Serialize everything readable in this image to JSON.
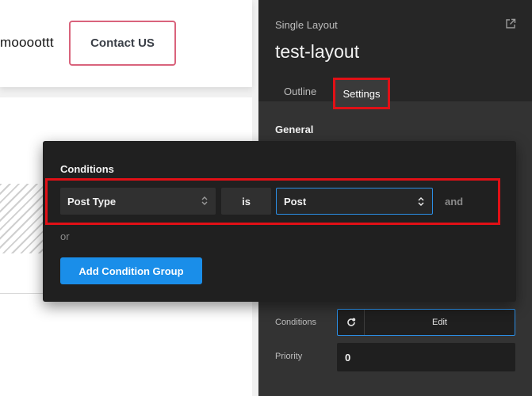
{
  "preview": {
    "brand_text": "moooottt",
    "contact_button": "Contact US"
  },
  "panel": {
    "subtitle": "Single Layout",
    "title": "test-layout",
    "tabs": [
      {
        "label": "Outline",
        "active": false
      },
      {
        "label": "Settings",
        "active": true
      }
    ],
    "section_general": "General",
    "conditions_label": "Conditions",
    "conditions_edit": "Edit",
    "priority_label": "Priority",
    "priority_value": "0"
  },
  "popover": {
    "title": "Conditions",
    "condition": {
      "type": "Post Type",
      "operator": "is",
      "value": "Post",
      "conjunction": "and"
    },
    "or_text": "or",
    "add_group_button": "Add Condition Group"
  },
  "colors": {
    "accent_blue": "#1a8ee9",
    "highlight_red": "#e11016",
    "contact_border": "#d9637c"
  },
  "icons": [
    "export-icon",
    "chevron-updown-icon",
    "refresh-settings-icon"
  ]
}
